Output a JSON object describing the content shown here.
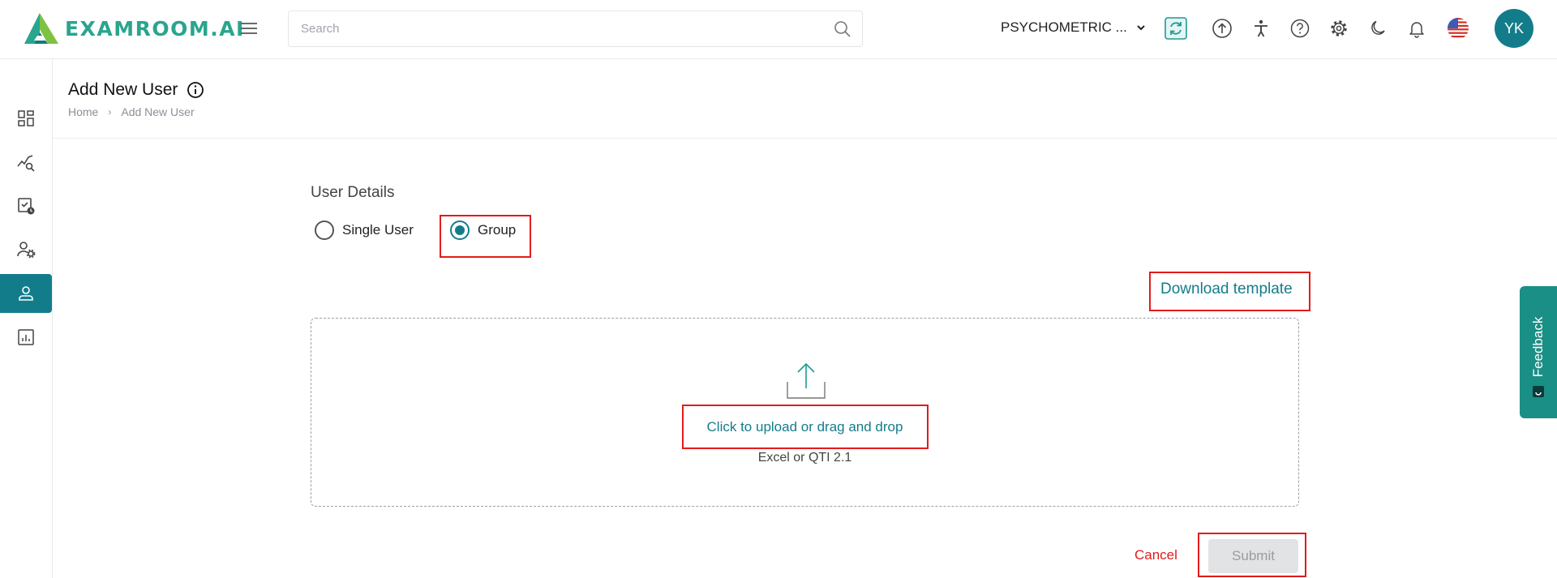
{
  "app": {
    "logo_text": "EXAMROOM.AI"
  },
  "header": {
    "search_placeholder": "Search",
    "org_selector": "PSYCHOMETRIC ...",
    "avatar_initials": "YK"
  },
  "page": {
    "title": "Add New User",
    "breadcrumb": {
      "home": "Home",
      "current": "Add New User"
    }
  },
  "form": {
    "section_title": "User Details",
    "radio_single": "Single User",
    "radio_group": "Group",
    "selected": "Group",
    "download_template": "Download template",
    "upload_link": "Click to upload or drag and drop",
    "upload_formats": "Excel or QTI 2.1",
    "cancel": "Cancel",
    "submit": "Submit"
  },
  "feedback": {
    "label": "Feedback"
  },
  "colors": {
    "accent": "#137c8b",
    "logo": "#2aa58e",
    "highlight": "#e31b1b",
    "feedback": "#1a8f85"
  }
}
